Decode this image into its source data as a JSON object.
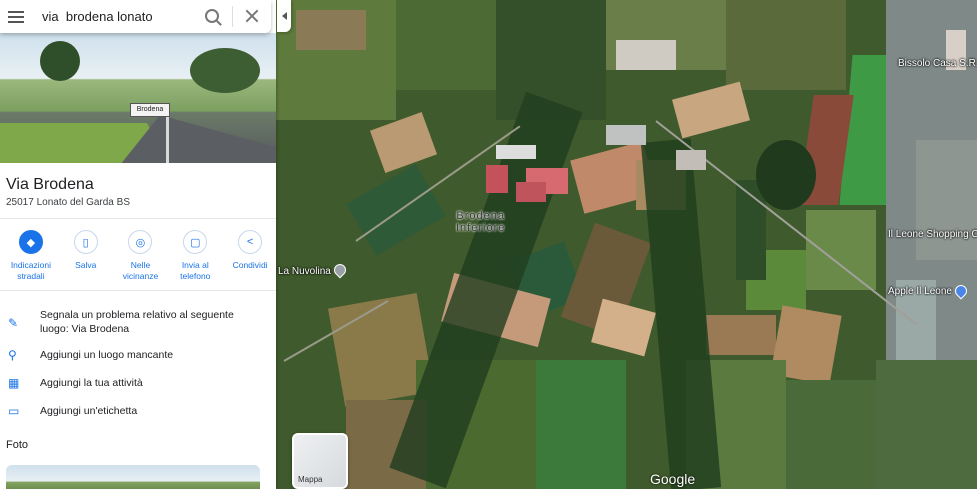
{
  "search": {
    "value": "via  brodena lonato"
  },
  "place": {
    "title": "Via Brodena",
    "address": "25017 Lonato del Garda BS",
    "street_sign": "Brodena"
  },
  "actions": [
    {
      "label": "Indicazioni stradali",
      "icon": "directions-icon"
    },
    {
      "label": "Salva",
      "icon": "bookmark-icon"
    },
    {
      "label": "Nelle vicinanze",
      "icon": "nearby-icon"
    },
    {
      "label": "Invia al telefono",
      "icon": "send-to-phone-icon"
    },
    {
      "label": "Condividi",
      "icon": "share-icon"
    }
  ],
  "links": [
    {
      "label": "Segnala un problema relativo al seguente luogo: Via Brodena",
      "icon": "edit-icon"
    },
    {
      "label": "Aggiungi un luogo mancante",
      "icon": "add-location-icon"
    },
    {
      "label": "Aggiungi la tua attività",
      "icon": "add-business-icon"
    },
    {
      "label": "Aggiungi un'etichetta",
      "icon": "label-icon"
    }
  ],
  "photos_title": "Foto",
  "map": {
    "labels": {
      "brodena": "Brodena\nInferiore",
      "nuvolina": "La Nuvolina",
      "bissolo": "Bissolo Casa S.R.L",
      "leone_shopping": "Il Leone Shopping Ce",
      "apple": "Apple Il Leone"
    },
    "layer_label": "Mappa",
    "brand": "Google"
  },
  "colors": {
    "accent": "#1a73e8"
  }
}
